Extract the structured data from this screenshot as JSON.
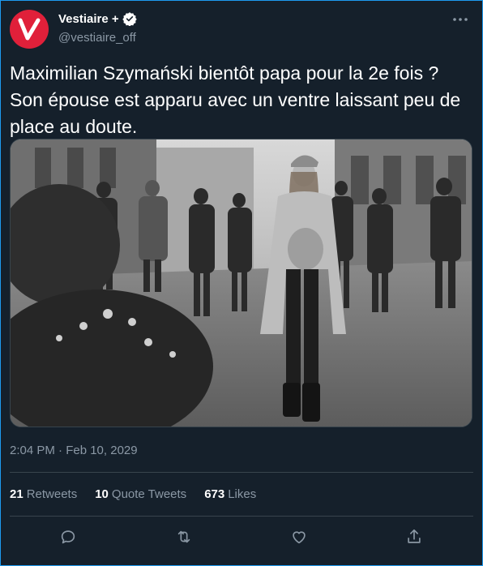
{
  "account": {
    "name": "Vestiaire +",
    "handle": "@vestiaire_off",
    "avatar_color": "#e0203a"
  },
  "tweet": {
    "text": "Maximilian Szymański bientôt papa pour la 2e fois ? Son épouse est apparu avec un ventre laissant peu de place au doute.",
    "timestamp": "2:04 PM · Feb 10, 2029"
  },
  "stats": {
    "retweets_count": "21",
    "retweets_label": "Retweets",
    "quotes_count": "10",
    "quotes_label": "Quote Tweets",
    "likes_count": "673",
    "likes_label": "Likes"
  },
  "actions": [
    "reply-icon",
    "retweet-icon",
    "like-icon",
    "share-icon"
  ],
  "colors": {
    "background": "#15202b",
    "accent": "#1d9bf0",
    "secondary_text": "#8b98a5",
    "divider": "#38444d"
  }
}
